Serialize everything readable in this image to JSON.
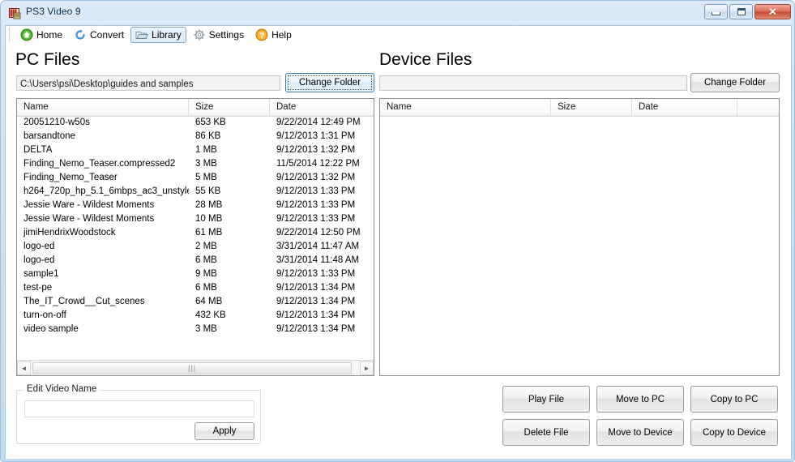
{
  "window": {
    "title": "PS3 Video 9",
    "icon": "app-icon",
    "buttons": {
      "minimize": "minimize-icon",
      "maximize": "maximize-icon",
      "close": "✕"
    }
  },
  "toolbar": {
    "items": [
      {
        "label": "Home",
        "icon": "home-icon",
        "selected": false
      },
      {
        "label": "Convert",
        "icon": "convert-icon",
        "selected": false
      },
      {
        "label": "Library",
        "icon": "folder-icon",
        "selected": true
      },
      {
        "label": "Settings",
        "icon": "gear-icon",
        "selected": false
      },
      {
        "label": "Help",
        "icon": "help-icon",
        "selected": false
      }
    ]
  },
  "pc_panel": {
    "title": "PC Files",
    "path_value": "C:\\Users\\psi\\Desktop\\guides and samples",
    "path_placeholder": "",
    "change_folder_label": "Change Folder",
    "columns": [
      "Name",
      "Size",
      "Date"
    ],
    "rows": [
      {
        "name": "20051210-w50s",
        "size": "653 KB",
        "date": "9/22/2014 12:49 PM"
      },
      {
        "name": "barsandtone",
        "size": "86 KB",
        "date": "9/12/2013 1:31 PM"
      },
      {
        "name": "DELTA",
        "size": "1 MB",
        "date": "9/12/2013 1:32 PM"
      },
      {
        "name": "Finding_Nemo_Teaser.compressed2",
        "size": "3 MB",
        "date": "11/5/2014 12:22 PM"
      },
      {
        "name": "Finding_Nemo_Teaser",
        "size": "5 MB",
        "date": "9/12/2013 1:32 PM"
      },
      {
        "name": "h264_720p_hp_5.1_6mbps_ac3_unstyle...",
        "size": "55 KB",
        "date": "9/12/2013 1:33 PM"
      },
      {
        "name": "Jessie Ware - Wildest Moments",
        "size": "28 MB",
        "date": "9/12/2013 1:33 PM"
      },
      {
        "name": "Jessie Ware - Wildest Moments",
        "size": "10 MB",
        "date": "9/12/2013 1:33 PM"
      },
      {
        "name": "jimiHendrixWoodstock",
        "size": "61 MB",
        "date": "9/22/2014 12:50 PM"
      },
      {
        "name": "logo-ed",
        "size": "2 MB",
        "date": "3/31/2014 11:47 AM"
      },
      {
        "name": "logo-ed",
        "size": "6 MB",
        "date": "3/31/2014 11:48 AM"
      },
      {
        "name": "sample1",
        "size": "9 MB",
        "date": "9/12/2013 1:33 PM"
      },
      {
        "name": "test-pe",
        "size": "6 MB",
        "date": "9/12/2013 1:34 PM"
      },
      {
        "name": "The_IT_Crowd__Cut_scenes",
        "size": "64 MB",
        "date": "9/12/2013 1:34 PM"
      },
      {
        "name": "turn-on-off",
        "size": "432 KB",
        "date": "9/12/2013 1:34 PM"
      },
      {
        "name": "video sample",
        "size": "3 MB",
        "date": "9/12/2013 1:34 PM"
      }
    ],
    "scrollbar": {
      "left_arrow": "◄",
      "right_arrow": "►",
      "grip": "|||"
    }
  },
  "device_panel": {
    "title": "Device Files",
    "path_value": "",
    "path_placeholder": "",
    "change_folder_label": "Change Folder",
    "columns": [
      "Name",
      "Size",
      "Date",
      ""
    ],
    "rows": []
  },
  "edit_video_name": {
    "legend": "Edit Video Name",
    "input_value": "",
    "input_placeholder": "",
    "apply_label": "Apply"
  },
  "actions": {
    "play_file": "Play File",
    "move_to_pc": "Move to PC",
    "copy_to_pc": "Copy to PC",
    "delete_file": "Delete File",
    "move_to_device": "Move to Device",
    "copy_to_device": "Copy to Device"
  },
  "colors": {
    "frame": "#cfe2f2",
    "selected_tab_border": "#7ca7c4",
    "focus_border": "#3c7fb1",
    "close_button": "#c44a33"
  }
}
